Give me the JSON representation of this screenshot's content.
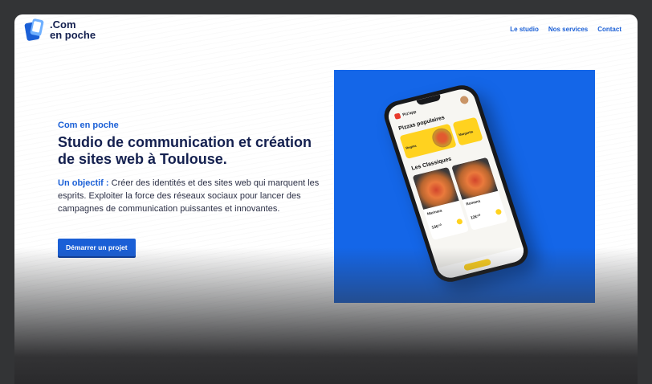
{
  "brand": {
    "line1": ".Com",
    "line2": "en poche",
    "colors": {
      "primary": "#1a5fd6",
      "navy": "#14204f",
      "panel": "#1466e8",
      "accent": "#ffd21f"
    }
  },
  "nav": {
    "items": [
      {
        "label": "Le studio"
      },
      {
        "label": "Nos services"
      },
      {
        "label": "Contact"
      }
    ]
  },
  "hero": {
    "eyebrow": "Com en poche",
    "title": "Studio de communication et création de sites web à Toulouse.",
    "lead": "Un objectif :",
    "description": " Créer des identités et des sites web qui marquent les esprits. Exploiter la force des réseaux sociaux pour lancer des campagnes de communication puissantes et innovantes.",
    "cta_label": "Démarrer un projet"
  },
  "phone_app": {
    "app_name": "Piz'app",
    "section_popular": "Pizzas populaires",
    "popular": [
      {
        "name": "Regina"
      },
      {
        "name": "Margarita"
      }
    ],
    "section_classics": "Les Classiques",
    "classics": [
      {
        "name": "Marinara",
        "price": "13€⁵⁰"
      },
      {
        "name": "Romana",
        "price": "12€⁵⁰"
      }
    ]
  }
}
